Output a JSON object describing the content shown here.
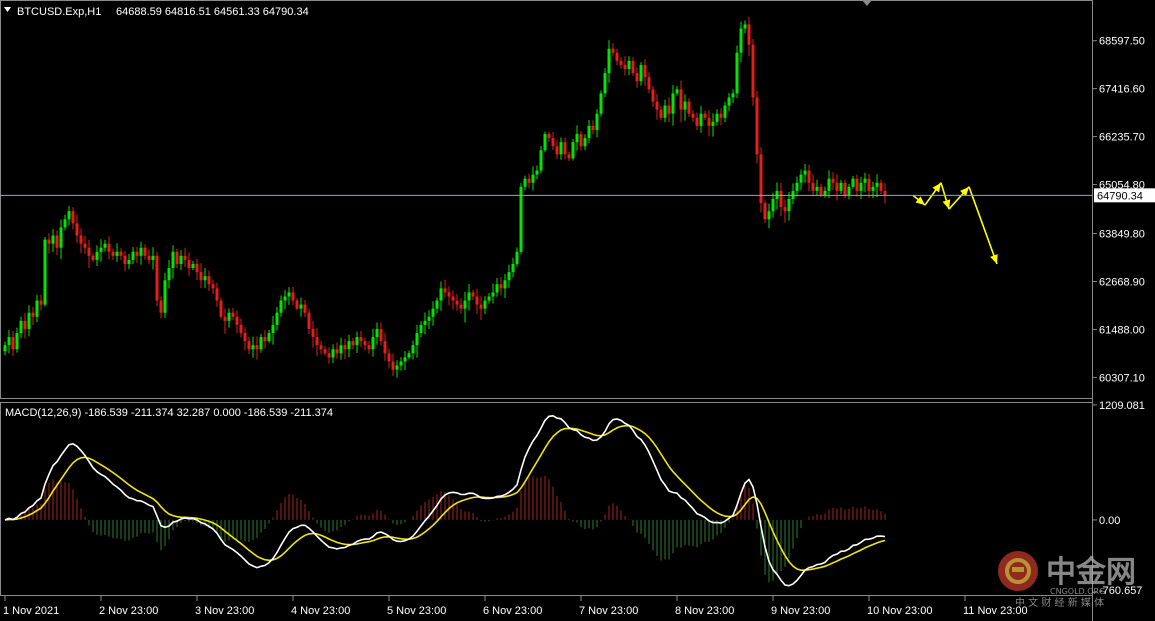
{
  "header": {
    "symbol": "BTCUSD.Exp,H1",
    "ohlc": "64688.59 64816.51 64561.33 64790.34"
  },
  "macd_header": "MACD(12,26,9) -186.539 -211.374 32.287 0.000 -186.539 -211.374",
  "watermark": {
    "brand": "中金网",
    "sub": "CNGOLD.ORG",
    "tagline": "中 文 财 经 新 媒 体"
  },
  "colors": {
    "bull": "#00e600",
    "bear": "#e0201c",
    "macd_line": "#ffffff",
    "signal_line": "#f2e311",
    "hist_pos": "#a32420",
    "hist_neg": "#2e7d32",
    "arrow": "#ffff00",
    "grid": "#8a8a8a",
    "price_line": "#9aa6b4"
  },
  "chart_data": [
    {
      "type": "candlestick",
      "timeframe": "H1",
      "current_price": 64790.34,
      "current_price_label": "64790.34",
      "ylim": [
        59800,
        69600
      ],
      "y_ticks": [
        68597.5,
        67416.6,
        66235.7,
        65054.8,
        63849.8,
        62668.9,
        61488.0,
        60307.1
      ],
      "y_tick_labels": [
        "68597.50",
        "67416.60",
        "66235.70",
        "65054.80",
        "63849.80",
        "62668.90",
        "61488.00",
        "60307.10"
      ],
      "x_tick_labels": [
        "1 Nov 2021",
        "2 Nov 23:00",
        "3 Nov 23:00",
        "4 Nov 23:00",
        "5 Nov 23:00",
        "6 Nov 23:00",
        "7 Nov 23:00",
        "8 Nov 23:00",
        "9 Nov 23:00",
        "10 Nov 23:00",
        "11 Nov 23:00"
      ],
      "x_tick_bars": [
        0,
        24,
        48,
        72,
        96,
        120,
        144,
        168,
        192,
        216,
        240
      ],
      "closes": [
        61100,
        61300,
        61000,
        61400,
        61700,
        61500,
        61900,
        61800,
        62200,
        62100,
        63700,
        63600,
        63800,
        63500,
        64000,
        64200,
        64400,
        64100,
        63800,
        63600,
        63500,
        63300,
        63200,
        63400,
        63500,
        63600,
        63400,
        63300,
        63400,
        63300,
        63100,
        63200,
        63400,
        63300,
        63500,
        63300,
        63200,
        63300,
        62200,
        61900,
        62700,
        63000,
        63400,
        63100,
        63300,
        63200,
        63000,
        63100,
        62900,
        62700,
        62800,
        62600,
        62500,
        62200,
        61800,
        61700,
        61900,
        61800,
        61600,
        61400,
        61200,
        61000,
        61100,
        61000,
        61300,
        61200,
        61400,
        61600,
        61900,
        62200,
        62300,
        62400,
        62200,
        62000,
        62100,
        61900,
        61500,
        61300,
        61100,
        61000,
        60900,
        60800,
        61000,
        60900,
        61100,
        61000,
        61200,
        61100,
        61300,
        61200,
        61100,
        61000,
        61300,
        61500,
        61200,
        60900,
        60700,
        60500,
        60600,
        60700,
        60800,
        60900,
        61100,
        61400,
        61600,
        61700,
        61800,
        62000,
        62200,
        62500,
        62400,
        62300,
        62200,
        62100,
        62000,
        62200,
        62400,
        62300,
        62100,
        62000,
        62200,
        62300,
        62400,
        62600,
        62500,
        62700,
        62900,
        63100,
        63400,
        65000,
        65200,
        65100,
        65300,
        65400,
        65900,
        66300,
        66200,
        66000,
        65800,
        66100,
        65800,
        65700,
        66100,
        66300,
        66000,
        66200,
        66500,
        66400,
        66800,
        67300,
        67800,
        68400,
        68300,
        68100,
        68000,
        67900,
        68100,
        67800,
        67600,
        68000,
        67700,
        67400,
        67100,
        66900,
        66700,
        67000,
        66800,
        67300,
        67400,
        66900,
        67100,
        66800,
        66700,
        66500,
        66800,
        66700,
        66500,
        66600,
        66800,
        66700,
        67000,
        67200,
        67300,
        68300,
        68900,
        69000,
        68500,
        67200,
        65800,
        64600,
        64200,
        64400,
        64700,
        64900,
        64500,
        64400,
        64700,
        64900,
        65100,
        65300,
        65400,
        65100,
        64900,
        65000,
        64800,
        64900,
        65200,
        65100,
        64900,
        65100,
        64800,
        65000,
        65200,
        64900,
        65100,
        65200,
        64900,
        65000,
        65100,
        64900,
        64800
      ],
      "macd_panel": {
        "label": "MACD(12,26,9)",
        "ylim": [
          -800,
          1240
        ],
        "y_ticks": [
          1209.081,
          0.0,
          -760.657
        ],
        "y_tick_labels": [
          "1209.081",
          "0.00",
          "-760.657"
        ]
      },
      "annotation": {
        "type": "projected-zigzag",
        "points": [
          [
            227,
            64790
          ],
          [
            230,
            64550
          ],
          [
            234,
            65100
          ],
          [
            236,
            64450
          ],
          [
            241,
            65000
          ],
          [
            248,
            63100
          ]
        ]
      }
    }
  ]
}
